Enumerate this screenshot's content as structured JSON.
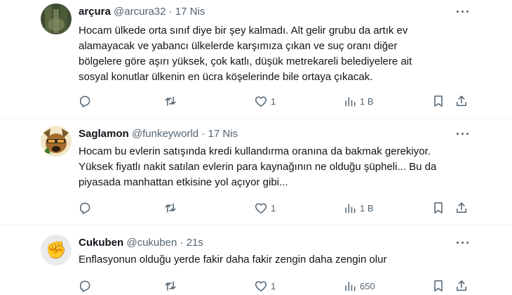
{
  "tweets": [
    {
      "name": "arçura",
      "handle": "@arcura32",
      "dot": "·",
      "time": "17 Nis",
      "lines": [
        "Hocam ülkede orta sınıf diye bir şey kalmadı. Alt gelir grubu da artık ev",
        "alamayacak ve yabancı ülkelerde karşımıza çıkan ve suç oranı diğer",
        "bölgelere göre aşırı yüksek, çok katlı, düşük metrekareli belediyelere ait",
        "sosyal konutlar ülkenin en ücra köşelerinde bile ortaya çıkacak."
      ],
      "likes": "1",
      "views": "1 B"
    },
    {
      "name": "Saglamon",
      "handle": "@funkeyworld",
      "dot": "·",
      "time": "17 Nis",
      "lines": [
        "Hocam bu evlerin satışında kredi kullandırma oranına da bakmak gerekiyor.",
        "Yüksek fiyatlı nakit satılan evlerin para kaynağının ne olduğu şüpheli... Bu da",
        "piyasada manhattan etkisine yol açıyor gibi..."
      ],
      "likes": "1",
      "views": "1 B"
    },
    {
      "name": "Cukuben",
      "handle": "@cukuben",
      "dot": "·",
      "time": "21s",
      "lines": [
        "Enflasyonun olduğu yerde fakir daha fakir zengin daha zengin olur"
      ],
      "avatar_emoji": "✊",
      "likes": "1",
      "views": "650"
    }
  ],
  "icons": {
    "reply": "reply-icon",
    "retweet": "retweet-icon",
    "like": "heart-icon",
    "views": "views-icon",
    "bookmark": "bookmark-icon",
    "share": "share-icon",
    "more": "more-icon"
  },
  "colors": {
    "text": "#0f1419",
    "muted": "#536471",
    "divider": "#eff3f4"
  }
}
